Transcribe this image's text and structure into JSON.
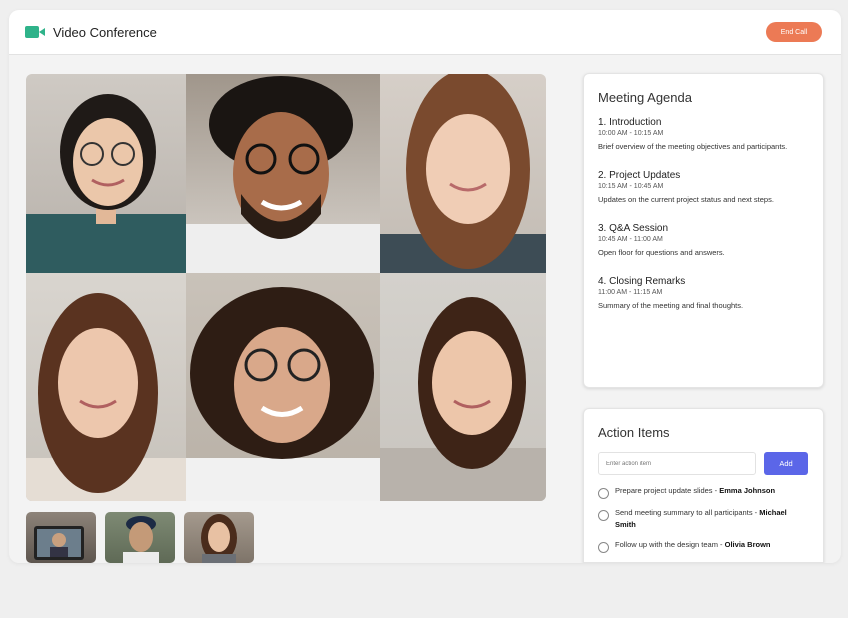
{
  "header": {
    "title": "Video Conference",
    "end_call_label": "End Call",
    "brand_color": "#2fb38a",
    "end_call_color": "#ec7a55"
  },
  "agenda": {
    "title": "Meeting Agenda",
    "items": [
      {
        "title": "1. Introduction",
        "time": "10:00 AM - 10:15 AM",
        "description": "Brief overview of the meeting objectives and participants."
      },
      {
        "title": "2. Project Updates",
        "time": "10:15 AM - 10:45 AM",
        "description": "Updates on the current project status and next steps."
      },
      {
        "title": "3. Q&A Session",
        "time": "10:45 AM - 11:00 AM",
        "description": "Open floor for questions and answers."
      },
      {
        "title": "4. Closing Remarks",
        "time": "11:00 AM - 11:15 AM",
        "description": "Summary of the meeting and final thoughts."
      }
    ]
  },
  "action_items": {
    "title": "Action Items",
    "input_placeholder": "Enter action item",
    "add_label": "Add",
    "add_color": "#5b66e8",
    "items": [
      {
        "text": "Prepare project update slides - ",
        "assignee": "Emma Johnson"
      },
      {
        "text": "Send meeting summary to all participants - ",
        "assignee": "Michael Smith"
      },
      {
        "text": "Follow up with the design team - ",
        "assignee": "Olivia Brown"
      }
    ]
  }
}
